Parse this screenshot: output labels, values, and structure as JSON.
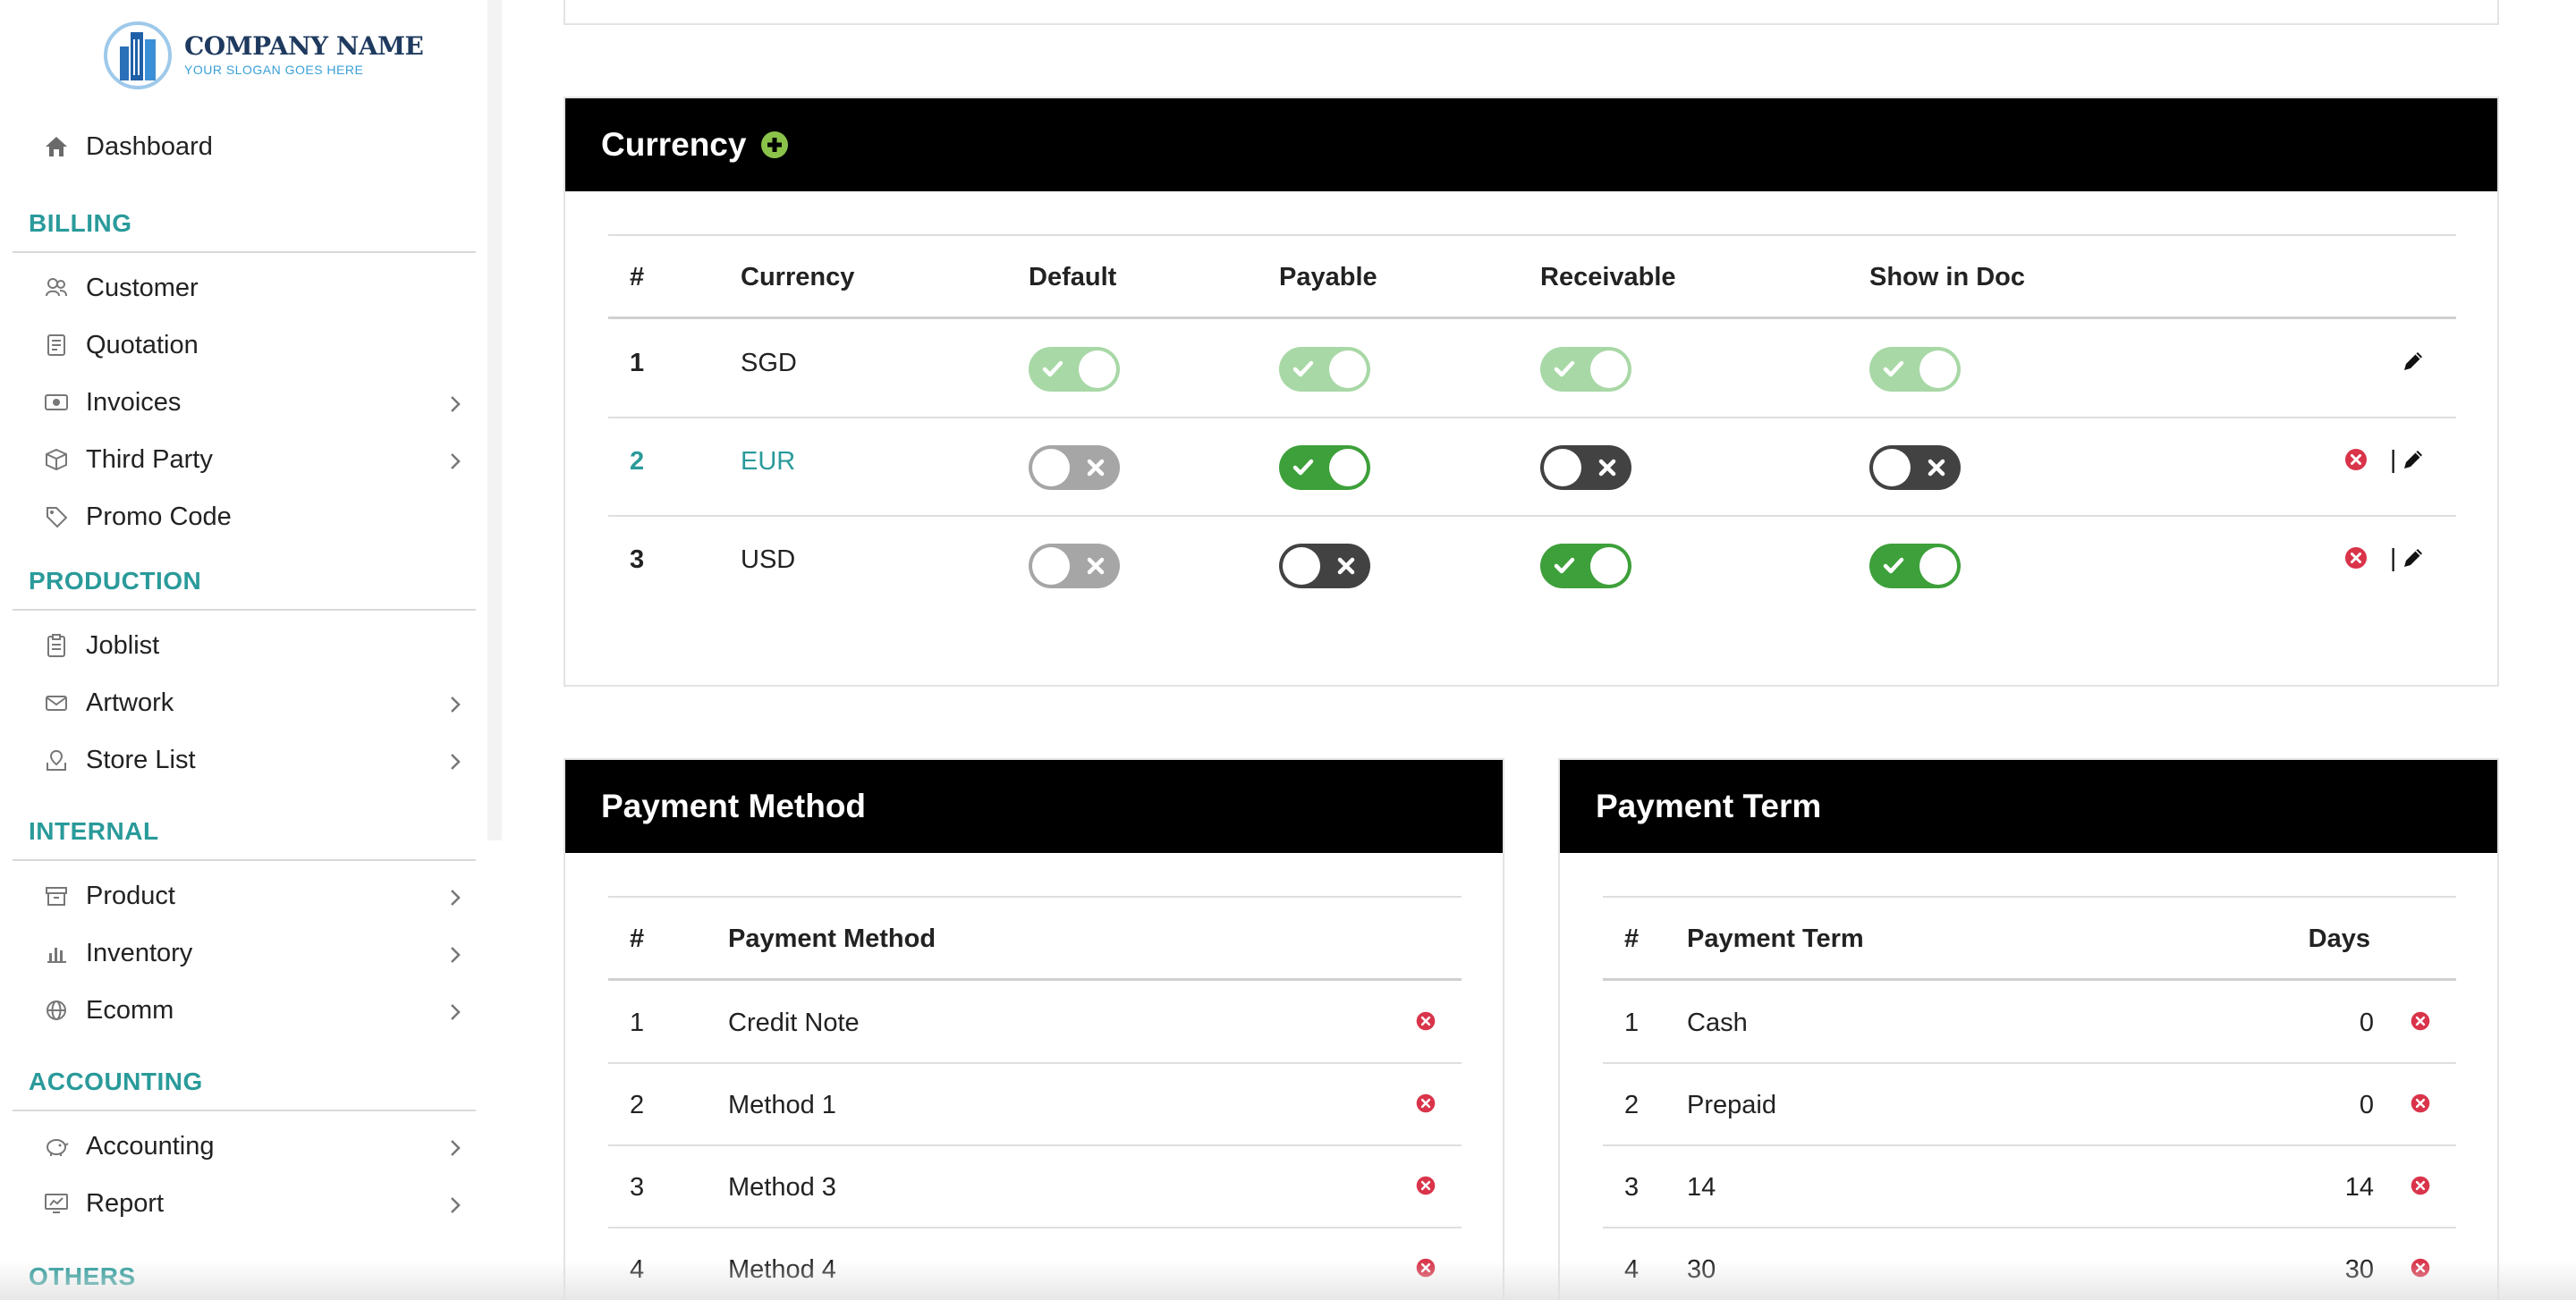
{
  "logo": {
    "name": "COMPANY NAME",
    "slogan": "YOUR SLOGAN GOES HERE"
  },
  "sidebar": {
    "dashboard": "Dashboard",
    "sections": [
      {
        "title": "BILLING",
        "items": [
          {
            "label": "Customer",
            "icon": "customer-icon",
            "chevron": false
          },
          {
            "label": "Quotation",
            "icon": "quotation-icon",
            "chevron": false
          },
          {
            "label": "Invoices",
            "icon": "invoice-icon",
            "chevron": true
          },
          {
            "label": "Third Party",
            "icon": "box-icon",
            "chevron": true
          },
          {
            "label": "Promo Code",
            "icon": "tag-icon",
            "chevron": false
          }
        ]
      },
      {
        "title": "PRODUCTION",
        "items": [
          {
            "label": "Joblist",
            "icon": "clipboard-icon",
            "chevron": false
          },
          {
            "label": "Artwork",
            "icon": "envelope-icon",
            "chevron": true
          },
          {
            "label": "Store List",
            "icon": "map-icon",
            "chevron": true
          }
        ]
      },
      {
        "title": "INTERNAL",
        "items": [
          {
            "label": "Product",
            "icon": "archive-icon",
            "chevron": true
          },
          {
            "label": "Inventory",
            "icon": "bar-chart-icon",
            "chevron": true
          },
          {
            "label": "Ecomm",
            "icon": "globe-icon",
            "chevron": true
          }
        ]
      },
      {
        "title": "ACCOUNTING",
        "items": [
          {
            "label": "Accounting",
            "icon": "piggy-bank-icon",
            "chevron": true
          },
          {
            "label": "Report",
            "icon": "report-icon",
            "chevron": true
          }
        ]
      },
      {
        "title": "OTHERS",
        "items": []
      }
    ]
  },
  "currency": {
    "title": "Currency",
    "headers": [
      "#",
      "Currency",
      "Default",
      "Payable",
      "Receivable",
      "Show in Doc"
    ],
    "rows": [
      {
        "num": "1",
        "code": "SGD",
        "highlight": false,
        "default": "on-disabled",
        "payable": "on-disabled",
        "receivable": "on-disabled",
        "show_in_doc": "on-disabled",
        "deletable": false
      },
      {
        "num": "2",
        "code": "EUR",
        "highlight": true,
        "default": "off-disabled",
        "payable": "on",
        "receivable": "off",
        "show_in_doc": "off",
        "deletable": true
      },
      {
        "num": "3",
        "code": "USD",
        "highlight": false,
        "default": "off-disabled",
        "payable": "off",
        "receivable": "on",
        "show_in_doc": "on",
        "deletable": true
      }
    ],
    "separator": "|"
  },
  "payment_method": {
    "title": "Payment Method",
    "headers": [
      "#",
      "Payment Method"
    ],
    "rows": [
      {
        "num": "1",
        "name": "Credit Note"
      },
      {
        "num": "2",
        "name": "Method 1"
      },
      {
        "num": "3",
        "name": "Method 3"
      },
      {
        "num": "4",
        "name": "Method 4"
      }
    ]
  },
  "payment_term": {
    "title": "Payment Term",
    "headers": [
      "#",
      "Payment Term",
      "Days"
    ],
    "rows": [
      {
        "num": "1",
        "name": "Cash",
        "days": "0"
      },
      {
        "num": "2",
        "name": "Prepaid",
        "days": "0"
      },
      {
        "num": "3",
        "name": "14",
        "days": "14"
      },
      {
        "num": "4",
        "name": "30",
        "days": "30"
      }
    ]
  },
  "colors": {
    "accent": "#2a9a9a",
    "toggle_on": "#3da03a",
    "toggle_on_disabled": "#a8d8a6",
    "toggle_off": "#424242",
    "toggle_off_disabled": "#a6a6a6",
    "delete": "#d9344a"
  }
}
